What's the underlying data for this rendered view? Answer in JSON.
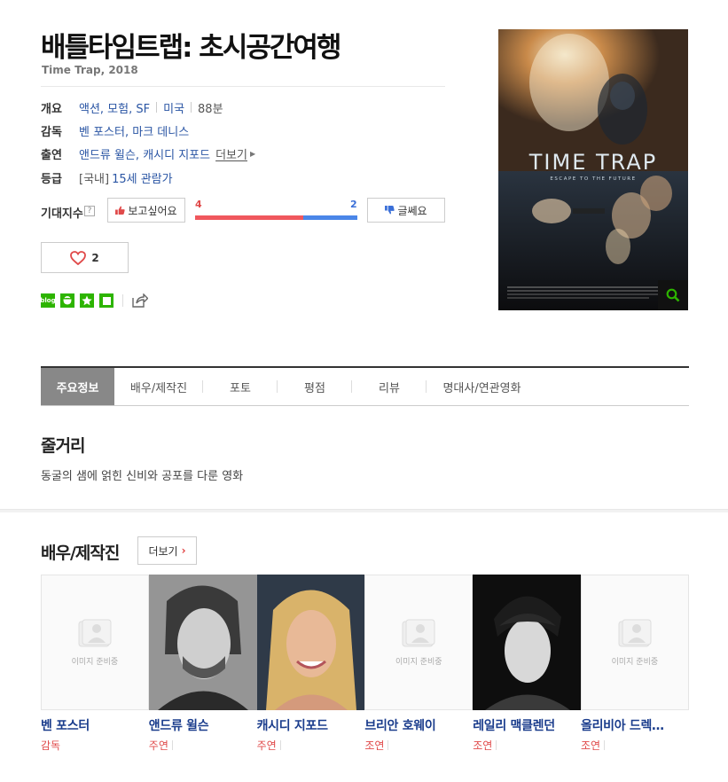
{
  "movie": {
    "title": "배틀타임트랩: 초시공간여행",
    "subtitle": "Time Trap, 2018"
  },
  "info": {
    "overview_label": "개요",
    "genres": "액션, 모험, SF",
    "country": "미국",
    "runtime": "88분",
    "director_label": "감독",
    "directors": "벤 포스터, 마크 데니스",
    "cast_label": "출연",
    "cast": "앤드류 윌슨, 캐시디 지포드",
    "cast_more": "더보기",
    "rating_label": "등급",
    "rating_prefix": "[국내]",
    "rating": "15세 관람가"
  },
  "expectation": {
    "label": "기대지수",
    "help": "?",
    "want_label": "보고싶어요",
    "not_label": "글쎄요",
    "want_count": "4",
    "not_count": "2",
    "want_ratio": 0.667
  },
  "like": {
    "count": "2"
  },
  "share": {
    "blog": "blog"
  },
  "poster": {
    "title_text": "TIME TRAP",
    "tagline": "ESCAPE TO THE FUTURE"
  },
  "tabs": [
    {
      "label": "주요정보"
    },
    {
      "label": "배우/제작진"
    },
    {
      "label": "포토"
    },
    {
      "label": "평점"
    },
    {
      "label": "리뷰"
    },
    {
      "label": "명대사/연관영화"
    }
  ],
  "plot": {
    "heading": "줄거리",
    "text": "동굴의 샘에 얽힌 신비와 공포를 다룬 영화"
  },
  "cast_section": {
    "heading": "배우/제작진",
    "more": "더보기",
    "no_photo": "이미지 준비중",
    "people": [
      {
        "name": "벤 포스터",
        "role": "감독"
      },
      {
        "name": "앤드류 윌슨",
        "role": "주연"
      },
      {
        "name": "캐시디 지포드",
        "role": "주연"
      },
      {
        "name": "브리안 호웨이",
        "role": "조연"
      },
      {
        "name": "레일리 맥클렌던",
        "role": "조연"
      },
      {
        "name": "올리비아 드렉…",
        "role": "조연"
      }
    ]
  },
  "colors": {
    "accent_red": "#f0575d",
    "accent_blue": "#4a86e8",
    "link_blue": "#2a55a4",
    "naver_green": "#2db400"
  }
}
